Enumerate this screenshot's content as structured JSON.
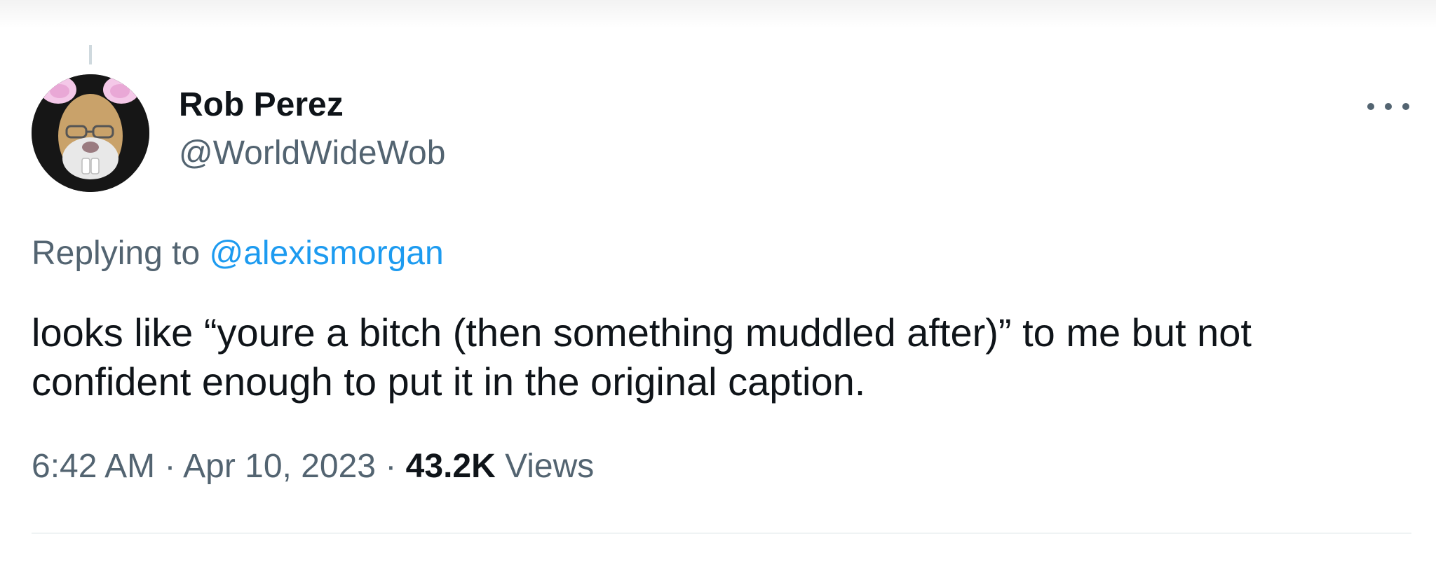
{
  "tweet": {
    "author": {
      "display_name": "Rob Perez",
      "handle": "@WorldWideWob",
      "avatar": "bunny-ears-face-avatar"
    },
    "reply_prefix": "Replying to",
    "reply_mention": "@alexismorgan",
    "text": "looks like “youre a bitch (then something muddled after)” to me but not confident enough to put it in the original caption.",
    "time": "6:42 AM",
    "date": "Apr 10, 2023",
    "separator": "·",
    "views_count": "43.2K",
    "views_label": "Views",
    "more_icon": "more-horizontal-icon"
  },
  "colors": {
    "text_primary": "#0f1419",
    "text_secondary": "#536471",
    "link": "#1d9bf0",
    "divider": "#eff3f4"
  }
}
